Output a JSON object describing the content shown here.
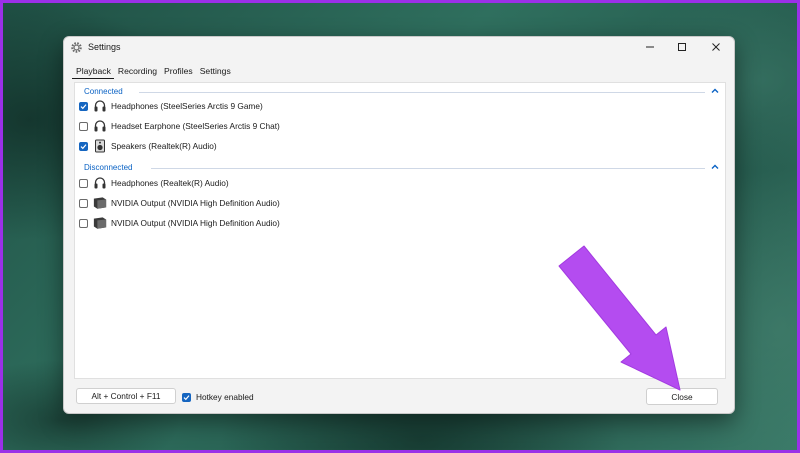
{
  "window": {
    "title": "Settings",
    "controls": [
      "minimize",
      "maximize",
      "close"
    ]
  },
  "tabs": [
    {
      "label": "Playback",
      "active": true
    },
    {
      "label": "Recording",
      "active": false
    },
    {
      "label": "Profiles",
      "active": false
    },
    {
      "label": "Settings",
      "active": false
    }
  ],
  "groups": [
    {
      "title": "Connected",
      "expanded": true,
      "devices": [
        {
          "label": "Headphones (SteelSeries Arctis 9 Game)",
          "checked": true,
          "icon": "headphones-icon"
        },
        {
          "label": "Headset Earphone (SteelSeries Arctis 9 Chat)",
          "checked": false,
          "icon": "headphones-icon"
        },
        {
          "label": "Speakers (Realtek(R) Audio)",
          "checked": true,
          "icon": "speaker-icon"
        }
      ]
    },
    {
      "title": "Disconnected",
      "expanded": true,
      "devices": [
        {
          "label": "Headphones (Realtek(R) Audio)",
          "checked": false,
          "icon": "headphones-icon"
        },
        {
          "label": "NVIDIA Output (NVIDIA High Definition Audio)",
          "checked": false,
          "icon": "monitor-icon"
        },
        {
          "label": "NVIDIA Output (NVIDIA High Definition Audio)",
          "checked": false,
          "icon": "monitor-icon"
        }
      ]
    }
  ],
  "footer": {
    "hotkey": "Alt + Control + F11",
    "hotkey_enabled_label": "Hotkey enabled",
    "hotkey_enabled": true,
    "close_label": "Close"
  },
  "colors": {
    "accent": "#1565c0",
    "group_title": "#0a62c4",
    "annotation_arrow": "#b44cf0",
    "frame_border": "#9b30e8"
  }
}
